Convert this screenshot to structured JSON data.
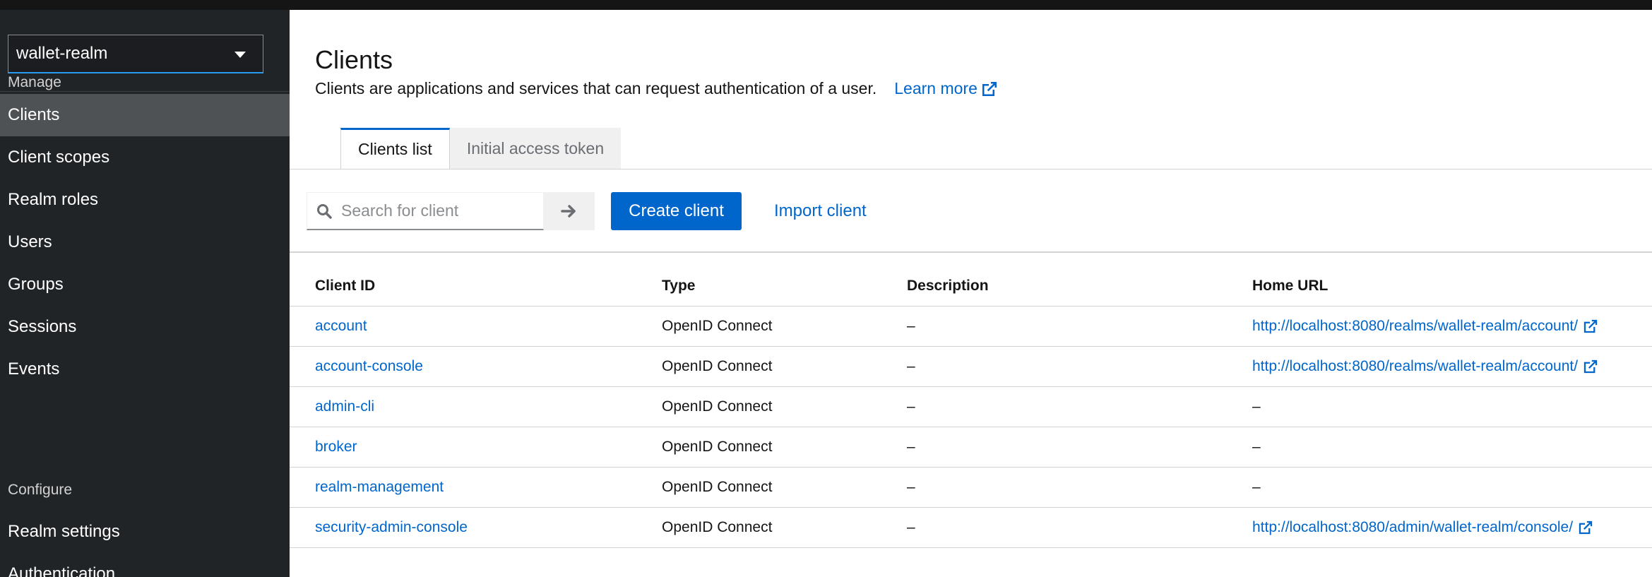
{
  "sidebar": {
    "realm_select": {
      "value": "wallet-realm"
    },
    "groups": [
      {
        "title": "Manage",
        "items": [
          {
            "label": "Clients",
            "active": true
          },
          {
            "label": "Client scopes"
          },
          {
            "label": "Realm roles"
          },
          {
            "label": "Users"
          },
          {
            "label": "Groups"
          },
          {
            "label": "Sessions"
          },
          {
            "label": "Events"
          }
        ]
      },
      {
        "title": "Configure",
        "items": [
          {
            "label": "Realm settings"
          },
          {
            "label": "Authentication"
          }
        ]
      }
    ]
  },
  "page": {
    "title": "Clients",
    "description": "Clients are applications and services that can request authentication of a user.",
    "learn_more": "Learn more"
  },
  "tabs": [
    {
      "label": "Clients list",
      "active": true
    },
    {
      "label": "Initial access token"
    }
  ],
  "toolbar": {
    "search_placeholder": "Search for client",
    "create_label": "Create client",
    "import_label": "Import client"
  },
  "table": {
    "columns": [
      "Client ID",
      "Type",
      "Description",
      "Home URL"
    ],
    "rows": [
      {
        "client_id": "account",
        "type": "OpenID Connect",
        "description": "–",
        "home_url": "http://localhost:8080/realms/wallet-realm/account/",
        "home_url_link": true
      },
      {
        "client_id": "account-console",
        "type": "OpenID Connect",
        "description": "–",
        "home_url": "http://localhost:8080/realms/wallet-realm/account/",
        "home_url_link": true
      },
      {
        "client_id": "admin-cli",
        "type": "OpenID Connect",
        "description": "–",
        "home_url": "–",
        "home_url_link": false
      },
      {
        "client_id": "broker",
        "type": "OpenID Connect",
        "description": "–",
        "home_url": "–",
        "home_url_link": false
      },
      {
        "client_id": "realm-management",
        "type": "OpenID Connect",
        "description": "–",
        "home_url": "–",
        "home_url_link": false
      },
      {
        "client_id": "security-admin-console",
        "type": "OpenID Connect",
        "description": "–",
        "home_url": "http://localhost:8080/admin/wallet-realm/console/",
        "home_url_link": true
      }
    ]
  },
  "colors": {
    "sidebar_bg": "#212427",
    "active_nav_bg": "#4f5255",
    "primary": "#0066cc",
    "link": "#0066cc"
  },
  "icons": {
    "realm_caret": "caret-down-icon",
    "external_link": "external-link-icon",
    "search": "search-icon",
    "arrow": "arrow-right-icon"
  }
}
